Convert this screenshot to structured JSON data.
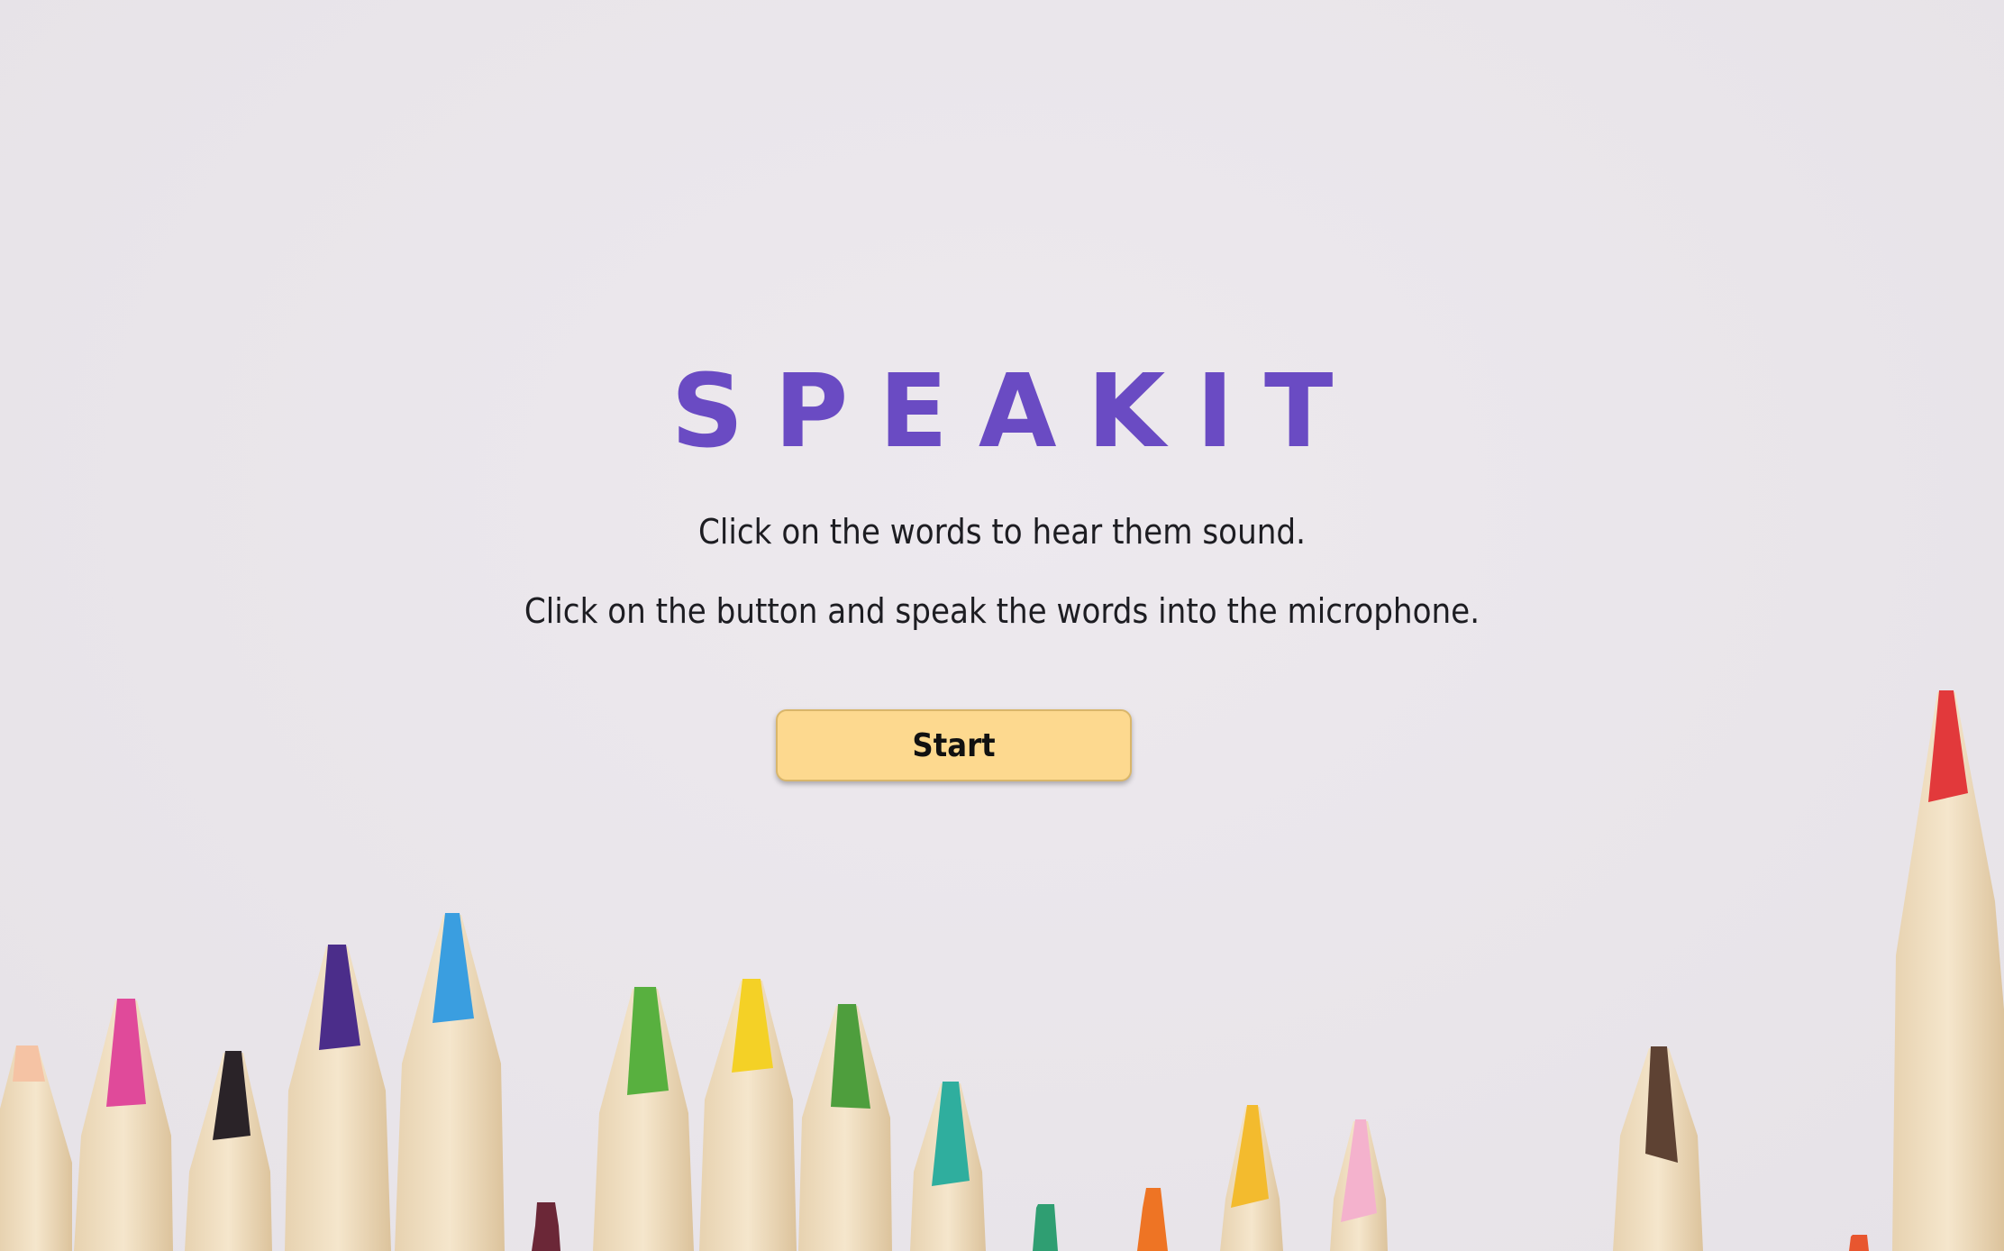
{
  "app": {
    "title": "SPEAKIT"
  },
  "instructions": {
    "line1": "Click on the words to hear them sound.",
    "line2": "Click on the button and speak the words into the microphone."
  },
  "start_button": {
    "label": "Start"
  },
  "colors": {
    "title": "#6a4bc3",
    "button_bg": "#fdd98f",
    "background": "#ebe7ec"
  },
  "decoration": {
    "pencil_colors": [
      "#f5c3a4",
      "#e04a9a",
      "#2a2328",
      "#4b2d8a",
      "#3a9ee0",
      "#6b2737",
      "#58b03f",
      "#f4d126",
      "#4e9e3d",
      "#2fae9e",
      "#2f9e72",
      "#ee7424",
      "#f3bb2e",
      "#f4b2cd",
      "#5e4233",
      "#e8562f",
      "#e2393b"
    ]
  }
}
